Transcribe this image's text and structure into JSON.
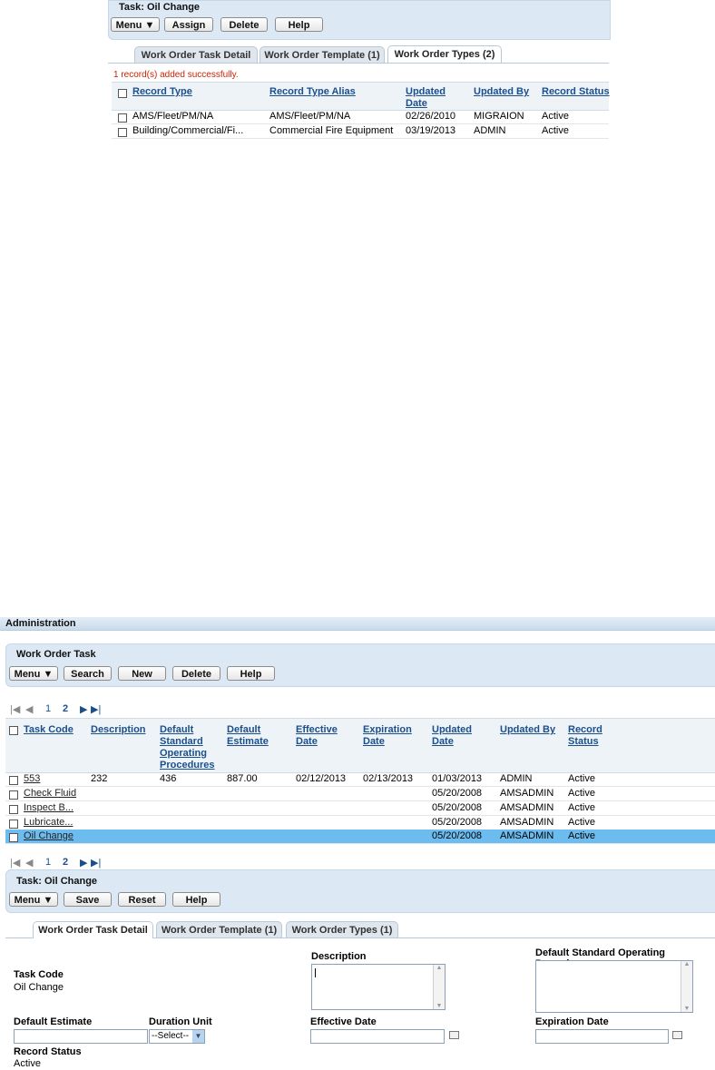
{
  "top": {
    "task_label": "Task:",
    "task_name": "Oil Change",
    "buttons": {
      "menu": "Menu",
      "assign": "Assign",
      "delete": "Delete",
      "help": "Help"
    },
    "tabs": [
      "Work Order Task Detail",
      "Work Order Template (1)",
      "Work Order Types (2)"
    ],
    "message": "1 record(s) added successfully.",
    "columns": [
      "Record Type",
      "Record Type Alias",
      "Updated Date",
      "Updated By",
      "Record Status"
    ],
    "rows": [
      [
        "AMS/Fleet/PM/NA",
        "AMS/Fleet/PM/NA",
        "02/26/2010",
        "MIGRAION",
        "Active"
      ],
      [
        "Building/Commercial/Fi...",
        "Commercial Fire Equipment",
        "03/19/2013",
        "ADMIN",
        "Active"
      ]
    ]
  },
  "admin": {
    "title": "Administration",
    "task_panel_title": "Work Order Task",
    "buttons": {
      "menu": "Menu",
      "search": "Search",
      "new": "New",
      "delete": "Delete",
      "help": "Help"
    },
    "pager": {
      "first": "◄",
      "prev": "◄",
      "p1": "1",
      "p2": "2",
      "next": "►",
      "last": "►"
    },
    "columns": [
      "Task Code",
      "Description",
      "Default Standard Operating Procedures",
      "Default Estimate",
      "Effective Date",
      "Expiration Date",
      "Updated Date",
      "Updated By",
      "Record Status"
    ],
    "rows": [
      [
        "553",
        "232",
        "436",
        "887.00",
        "02/12/2013",
        "02/13/2013",
        "01/03/2013",
        "ADMIN",
        "Active"
      ],
      [
        "Check Fluid",
        "",
        "",
        "",
        "",
        "",
        "05/20/2008",
        "AMSADMIN",
        "Active"
      ],
      [
        "Inspect B...",
        "",
        "",
        "",
        "",
        "",
        "05/20/2008",
        "AMSADMIN",
        "Active"
      ],
      [
        "Lubricate...",
        "",
        "",
        "",
        "",
        "",
        "05/20/2008",
        "AMSADMIN",
        "Active"
      ],
      [
        "Oil Change",
        "",
        "",
        "",
        "",
        "",
        "05/20/2008",
        "AMSADMIN",
        "Active"
      ]
    ],
    "detail": {
      "task_label": "Task:",
      "task_name": "Oil Change",
      "buttons": {
        "menu": "Menu",
        "save": "Save",
        "reset": "Reset",
        "help": "Help"
      },
      "tabs": [
        "Work Order Task Detail",
        "Work Order Template (1)",
        "Work Order Types (1)"
      ],
      "fields": {
        "task_code_label": "Task Code",
        "task_code_value": "Oil Change",
        "description_label": "Description",
        "description_value": "",
        "sop_label": "Default Standard Operating Procedures",
        "estimate_label": "Default Estimate",
        "estimate_value": "",
        "duration_label": "Duration Unit",
        "duration_value": "--Select--",
        "effective_label": "Effective Date",
        "effective_value": "",
        "expiration_label": "Expiration Date",
        "expiration_value": "",
        "status_label": "Record Status",
        "status_value": "Active"
      }
    }
  },
  "colors": {
    "accent": "#1a4f8b",
    "selected_row": "#6cbcf0",
    "panel": "#dce9f5",
    "message": "#cc2200"
  }
}
